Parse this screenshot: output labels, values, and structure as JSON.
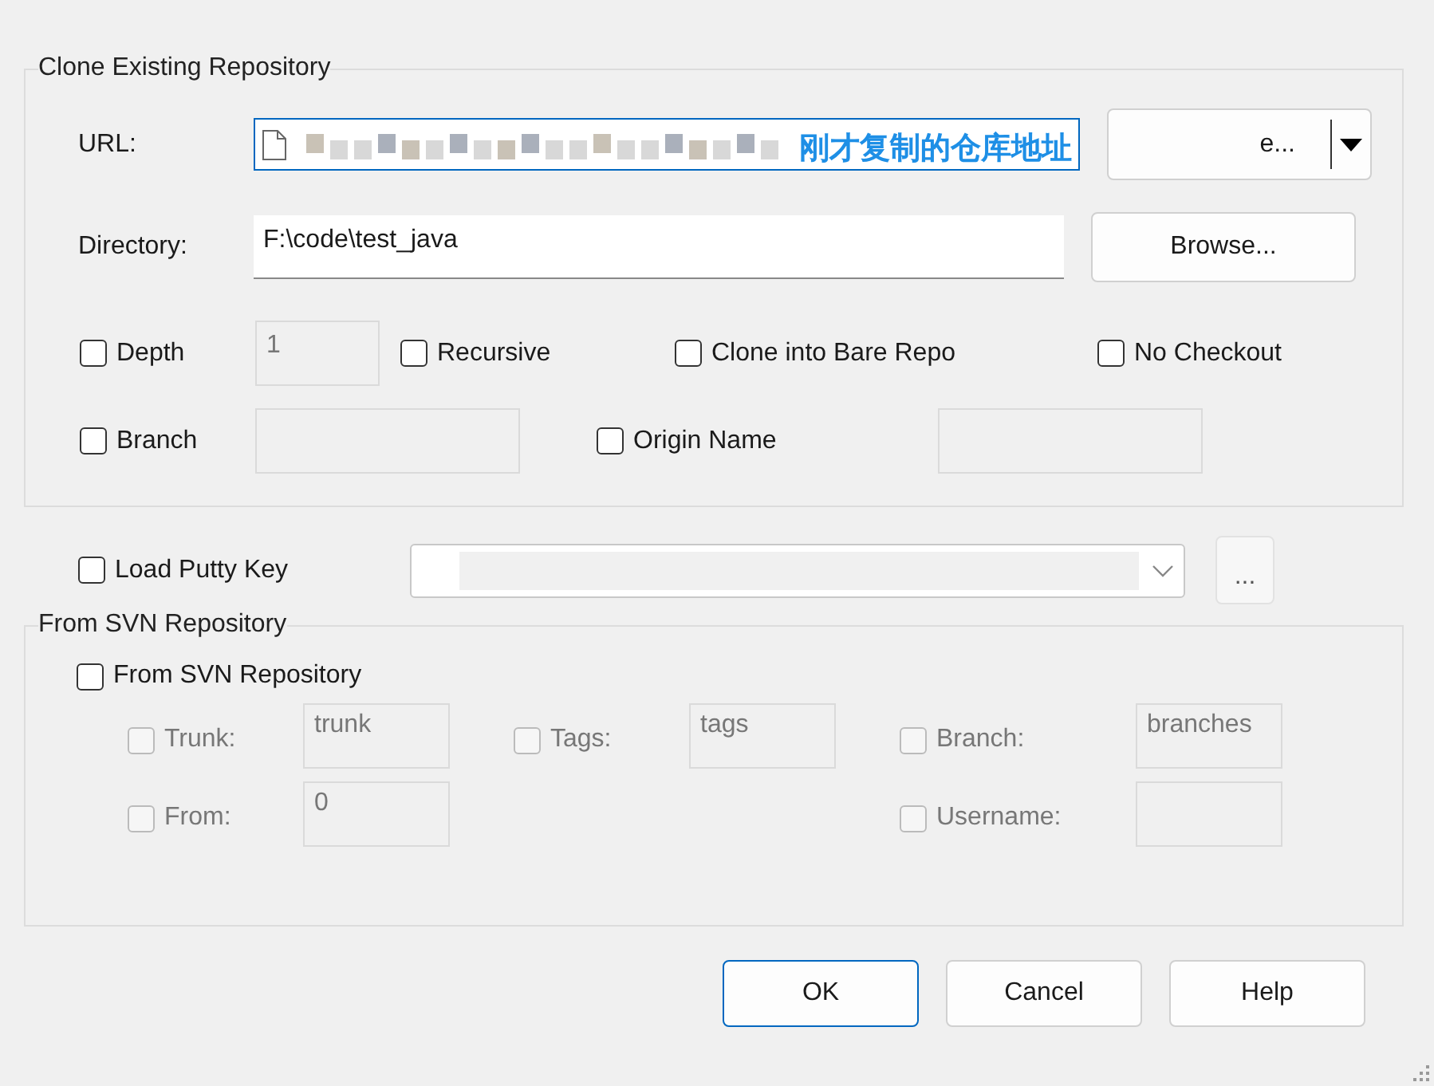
{
  "clone_group": {
    "title": "Clone Existing Repository",
    "url": {
      "label": "URL:",
      "browse_label": "e..."
    },
    "annotation": "刚才复制的仓库地址",
    "directory": {
      "label": "Directory:",
      "value": "F:\\code\\test_java",
      "browse_label": "Browse..."
    },
    "row_1": [
      {
        "kind": "check-field",
        "label": "Depth",
        "checked": false,
        "value": "1"
      },
      {
        "kind": "check",
        "label": "Recursive",
        "checked": false
      },
      {
        "kind": "check",
        "label": "Clone into Bare Repo",
        "checked": false
      },
      {
        "kind": "check",
        "label": "No Checkout",
        "checked": false
      }
    ],
    "row_2": [
      {
        "kind": "check-field",
        "label": "Branch",
        "checked": false
      },
      {
        "kind": "check-field",
        "label": "Origin Name",
        "checked": false
      }
    ]
  },
  "putty": {
    "label": "Load Putty Key",
    "checked": false,
    "button": "..."
  },
  "svn_group": {
    "title": "From SVN Repository",
    "enable": {
      "label": "From SVN Repository",
      "checked": false
    },
    "rows": [
      [
        {
          "label": "Trunk:",
          "checked": false,
          "disabled": true,
          "value": "trunk"
        },
        {
          "label": "Tags:",
          "checked": false,
          "disabled": true,
          "value": "tags"
        },
        {
          "label": "Branch:",
          "checked": false,
          "disabled": true,
          "value": "branches"
        }
      ],
      [
        {
          "label": "From:",
          "checked": false,
          "disabled": true,
          "value": "0"
        },
        null,
        {
          "label": "Username:",
          "checked": false,
          "disabled": true
        }
      ]
    ]
  },
  "buttons": [
    {
      "label": "OK",
      "selected": true
    },
    {
      "label": "Cancel",
      "selected": false
    },
    {
      "label": "Help",
      "selected": false
    }
  ]
}
